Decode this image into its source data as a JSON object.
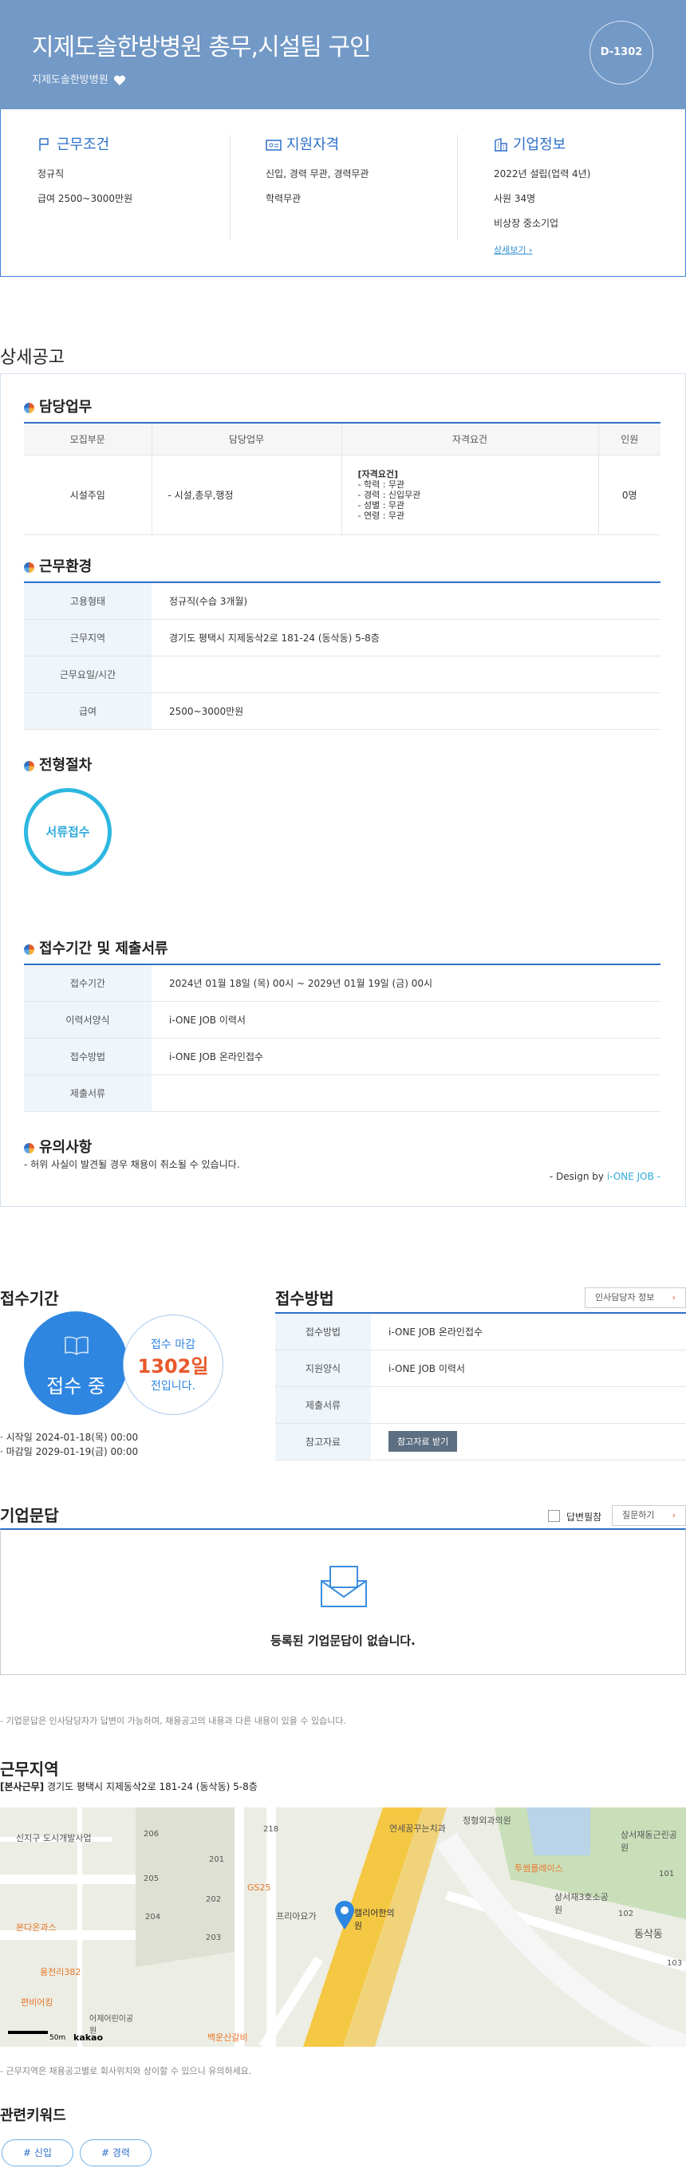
{
  "header": {
    "title": "지제도솔한방병원 총무,시설팀 구인",
    "company": "지제도솔한방병원",
    "dday": "D-1302"
  },
  "summary": {
    "conditions": {
      "title": "근무조건",
      "lines": [
        "정규직",
        "급여 2500~3000만원"
      ]
    },
    "qualification": {
      "title": "지원자격",
      "lines": [
        "신입, 경력 무관, 경력무관",
        "학력무관"
      ]
    },
    "company": {
      "title": "기업정보",
      "lines": [
        "2022년 설립(업력 4년)",
        "사원 34명",
        "비상장 중소기업"
      ],
      "link": "상세보기 ›"
    }
  },
  "detail": {
    "section_title": "상세공고",
    "duty": {
      "title": "담당업무",
      "headers": [
        "모집부문",
        "담당업무",
        "자격요건",
        "인원"
      ],
      "row": {
        "dept": "시설주임",
        "work": "- 시설,총무,행정",
        "req_title": "[자격요건]",
        "req_lines": [
          "- 학력 : 무관",
          "- 경력 : 신입무관",
          "- 성별 : 무관",
          "- 연령 : 무관"
        ],
        "count": "0명"
      }
    },
    "env": {
      "title": "근무환경",
      "rows": [
        {
          "k": "고용형태",
          "v": "정규직(수습 3개월)"
        },
        {
          "k": "근무지역",
          "v": "경기도 평택시 지제동삭2로 181-24 (동삭동) 5-8층"
        },
        {
          "k": "근무요일/시간",
          "v": ""
        },
        {
          "k": "급여",
          "v": "2500~3000만원"
        }
      ]
    },
    "process": {
      "title": "전형절차",
      "step": "서류접수"
    },
    "period": {
      "title": "접수기간 및 제출서류",
      "rows": [
        {
          "k": "접수기간",
          "v": "2024년 01월 18일 (목) 00시 ~ 2029년 01월 19일 (금) 00시"
        },
        {
          "k": "이력서양식",
          "v": "i-ONE JOB 이력서"
        },
        {
          "k": "접수방법",
          "v": "i-ONE JOB 온라인접수"
        },
        {
          "k": "제출서류",
          "v": ""
        }
      ]
    },
    "caution": {
      "title": "유의사항",
      "text": "- 허위 사실이 발견될 경우 채용이 취소될 수 있습니다."
    },
    "design_prefix": "- Design by ",
    "design_brand": "i-ONE JOB -"
  },
  "apply": {
    "period_title": "접수기간",
    "status": "접수 중",
    "deadline_label": "접수 마감",
    "deadline_days": "1302일",
    "deadline_suffix": "전입니다.",
    "start": "시작일 2024-01-18(목) 00:00",
    "end": "마감일 2029-01-19(금) 00:00",
    "method_title": "접수방법",
    "hr_button": "인사담당자 정보",
    "rows": [
      {
        "k": "접수방법",
        "v": "i-ONE JOB 온라인접수"
      },
      {
        "k": "지원양식",
        "v": "i-ONE JOB 이력서"
      },
      {
        "k": "제출서류",
        "v": ""
      },
      {
        "k": "참고자료",
        "v": ""
      }
    ],
    "ref_button": "참고자료 받기"
  },
  "qa": {
    "title": "기업문답",
    "checkbox_label": "답변필참",
    "ask_button": "질문하기",
    "empty": "등록된 기업문답이 없습니다.",
    "note": "- 기업문답은 인사담당자가 답변이 가능하며, 채용공고의 내용과 다른 내용이 있을 수 있습니다."
  },
  "location": {
    "title": "근무지역",
    "tag": "[본사근무]",
    "address": "경기도 평택시 지제동삭2로 181-24 (동삭동) 5-8층",
    "note": "- 근무지역은 채용공고별로 회사위치와 상이할 수 있으니 유의하세요.",
    "map_labels": [
      "신지구 도시개발사업",
      "206",
      "218",
      "연세꿈꾸는치과",
      "정형외과의원",
      "205",
      "201",
      "GS25",
      "투썸플레이스",
      "상서재동근린공원",
      "204",
      "202",
      "203",
      "프리아요가",
      "캘리어한의원",
      "상서재3호소공원",
      "동삭동",
      "본다온과스",
      "용전리382",
      "편비어킹",
      "어제어린이공원",
      "백운산갈비",
      "102",
      "103",
      "101",
      "50m",
      "kakao"
    ]
  },
  "keywords": {
    "title": "관련키워드",
    "items": [
      "# 신입",
      "# 경력"
    ]
  },
  "colors": {
    "header_bg": "#7399c6",
    "accent": "#2d6fc9",
    "status_blue": "#2f86e0",
    "deadline_orange": "#e8582a"
  }
}
